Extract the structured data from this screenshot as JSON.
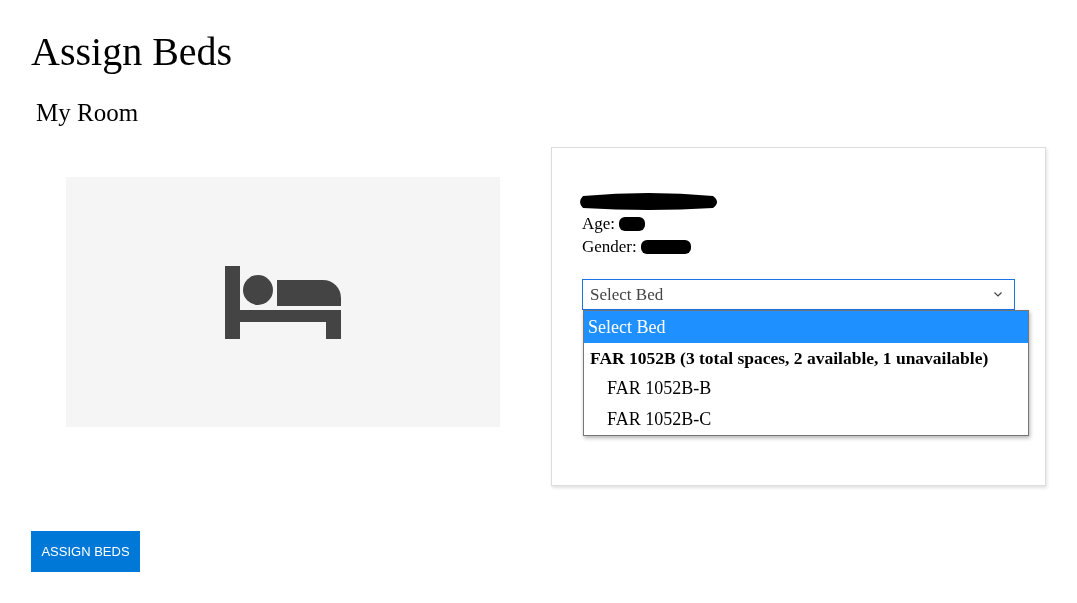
{
  "title": "Assign Beds",
  "section": "My Room",
  "resident": {
    "age_label": "Age:",
    "gender_label": "Gender:"
  },
  "bed_select": {
    "value": "Select Bed",
    "expanded": true,
    "options": [
      {
        "kind": "option",
        "label": "Select Bed",
        "selected": true
      },
      {
        "kind": "group",
        "label": "FAR 1052B (3 total spaces, 2 available, 1 unavailable)",
        "children": [
          {
            "label": "FAR 1052B-B",
            "selected": false
          },
          {
            "label": "FAR 1052B-C",
            "selected": false
          }
        ]
      }
    ]
  },
  "button": "ASSIGN BEDS"
}
